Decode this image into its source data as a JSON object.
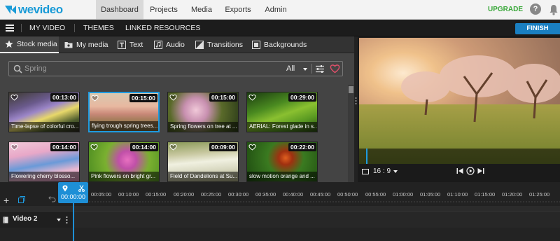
{
  "app": {
    "logo_text_we": "we",
    "logo_text_video": "video"
  },
  "topnav": {
    "tabs": [
      {
        "label": "Dashboard",
        "active": true
      },
      {
        "label": "Projects"
      },
      {
        "label": "Media"
      },
      {
        "label": "Exports"
      },
      {
        "label": "Admin"
      }
    ],
    "upgrade_label": "UPGRADE"
  },
  "subbar": {
    "project_title": "MY VIDEO",
    "themes_label": "THEMES",
    "linked_label": "LINKED RESOURCES",
    "finish_label": "FINISH"
  },
  "media_tabs": [
    {
      "label": "Stock media",
      "icon": "star-icon",
      "active": true
    },
    {
      "label": "My media",
      "icon": "folder-icon"
    },
    {
      "label": "Text",
      "icon": "text-icon"
    },
    {
      "label": "Audio",
      "icon": "audio-icon"
    },
    {
      "label": "Transitions",
      "icon": "transitions-icon"
    },
    {
      "label": "Backgrounds",
      "icon": "backgrounds-icon"
    }
  ],
  "search": {
    "placeholder": "Spring",
    "filter_value": "All"
  },
  "thumbnails": [
    {
      "label": "Time-lapse of colorful cro...",
      "duration": "00:13:00"
    },
    {
      "label": "flying trough spring trees...",
      "duration": "00:15:00",
      "selected": true
    },
    {
      "label": "Spring flowers on tree at ...",
      "duration": "00:15:00"
    },
    {
      "label": "AERIAL: Forest glade in s...",
      "duration": "00:29:00"
    },
    {
      "label": "Flowering cherry blosso...",
      "duration": "00:14:00"
    },
    {
      "label": "Pink flowers on bright gr...",
      "duration": "00:14:00"
    },
    {
      "label": "Field of Dandelions at Su...",
      "duration": "00:09:00"
    },
    {
      "label": "slow motion orange and ...",
      "duration": "00:22:00"
    }
  ],
  "preview": {
    "aspect_ratio": "16 : 9"
  },
  "timeline": {
    "playhead_time": "00:00:00",
    "ticks": [
      "00:05:00",
      "00:10:00",
      "00:15:00",
      "00:20:00",
      "00:25:00",
      "00:30:00",
      "00:35:00",
      "00:40:00",
      "00:45:00",
      "00:50:00",
      "00:55:00",
      "01:00:00",
      "01:05:00",
      "01:10:00",
      "01:15:00",
      "01:20:00",
      "01:25:00"
    ],
    "tracks": [
      {
        "name": "Video 2"
      }
    ]
  },
  "colors": {
    "accent": "#1e8fd6",
    "upgrade": "#3aa83a",
    "heart": "#e0506a"
  }
}
